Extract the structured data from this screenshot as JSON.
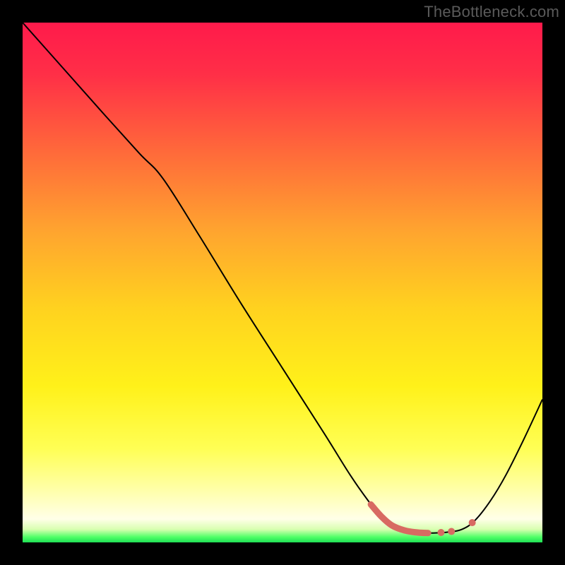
{
  "watermark": "TheBottleneck.com",
  "chart_data": {
    "type": "line",
    "title": "",
    "xlabel": "",
    "ylabel": "",
    "xlim": [
      0,
      100
    ],
    "ylim": [
      0,
      100
    ],
    "background_gradient": {
      "stops": [
        {
          "offset": 0.0,
          "color": "#ff1a4b"
        },
        {
          "offset": 0.1,
          "color": "#ff2f47"
        },
        {
          "offset": 0.25,
          "color": "#ff6a3a"
        },
        {
          "offset": 0.4,
          "color": "#ffa42f"
        },
        {
          "offset": 0.55,
          "color": "#ffd21f"
        },
        {
          "offset": 0.7,
          "color": "#fff11a"
        },
        {
          "offset": 0.82,
          "color": "#ffff55"
        },
        {
          "offset": 0.9,
          "color": "#ffffaa"
        },
        {
          "offset": 0.955,
          "color": "#ffffe8"
        },
        {
          "offset": 0.975,
          "color": "#d8ffb0"
        },
        {
          "offset": 0.99,
          "color": "#4dff66"
        },
        {
          "offset": 1.0,
          "color": "#1fe055"
        }
      ]
    },
    "series": [
      {
        "name": "bottleneck-curve",
        "color": "#000000",
        "width": 2,
        "points": [
          {
            "x": 0.0,
            "y": 100.0
          },
          {
            "x": 8.0,
            "y": 91.0
          },
          {
            "x": 16.0,
            "y": 82.0
          },
          {
            "x": 22.5,
            "y": 74.8
          },
          {
            "x": 27.0,
            "y": 70.0
          },
          {
            "x": 34.0,
            "y": 59.0
          },
          {
            "x": 42.0,
            "y": 46.0
          },
          {
            "x": 50.0,
            "y": 33.5
          },
          {
            "x": 58.0,
            "y": 21.0
          },
          {
            "x": 63.0,
            "y": 13.0
          },
          {
            "x": 66.5,
            "y": 8.0
          },
          {
            "x": 69.0,
            "y": 5.0
          },
          {
            "x": 71.0,
            "y": 3.3
          },
          {
            "x": 73.5,
            "y": 2.3
          },
          {
            "x": 76.0,
            "y": 1.9
          },
          {
            "x": 79.0,
            "y": 1.8
          },
          {
            "x": 82.0,
            "y": 2.0
          },
          {
            "x": 84.5,
            "y": 2.5
          },
          {
            "x": 87.0,
            "y": 4.2
          },
          {
            "x": 90.0,
            "y": 8.0
          },
          {
            "x": 93.0,
            "y": 13.0
          },
          {
            "x": 96.5,
            "y": 20.0
          },
          {
            "x": 100.0,
            "y": 27.5
          }
        ]
      },
      {
        "name": "highlight-segment",
        "color": "#d86a62",
        "width": 9,
        "linecap": "round",
        "points": [
          {
            "x": 67.0,
            "y": 7.3
          },
          {
            "x": 69.0,
            "y": 5.0
          },
          {
            "x": 71.0,
            "y": 3.3
          },
          {
            "x": 73.5,
            "y": 2.3
          },
          {
            "x": 76.0,
            "y": 1.9
          },
          {
            "x": 78.0,
            "y": 1.8
          }
        ]
      }
    ],
    "highlight_dots": {
      "color": "#d86a62",
      "radius": 5,
      "points": [
        {
          "x": 80.5,
          "y": 1.9
        },
        {
          "x": 82.5,
          "y": 2.1
        },
        {
          "x": 86.5,
          "y": 3.8
        }
      ]
    }
  }
}
